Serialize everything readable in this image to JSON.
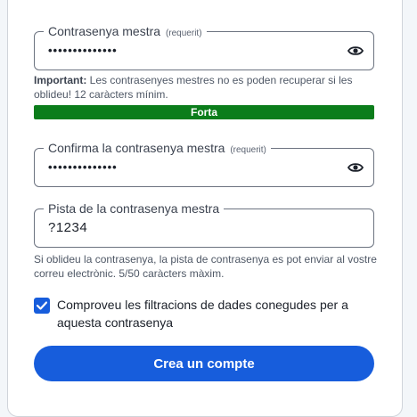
{
  "colors": {
    "accent": "#175ddc",
    "strength_strong": "#0b7d1b"
  },
  "master_password": {
    "label": "Contrasenya mestra",
    "required_tag": "(requerit)",
    "value": "••••••••••••••",
    "toggle_icon": "eye-icon"
  },
  "important_note": {
    "bold": "Important:",
    "text": " Les contrasenyes mestres no es poden recuperar si les oblideu! 12 caràcters mínim."
  },
  "strength": {
    "label": "Forta"
  },
  "confirm_password": {
    "label": "Confirma la contrasenya mestra",
    "required_tag": "(requerit)",
    "value": "••••••••••••••",
    "toggle_icon": "eye-icon"
  },
  "hint": {
    "label": "Pista de la contrasenya mestra",
    "value": "?1234",
    "helper": "Si oblideu la contrasenya, la pista de contrasenya es pot enviar al vostre correu electrònic. 5/50 caràcters màxim."
  },
  "breach_check": {
    "checked": true,
    "label": "Comproveu les filtracions de dades conegudes per a aquesta contrasenya"
  },
  "submit": {
    "label": "Crea un compte"
  }
}
